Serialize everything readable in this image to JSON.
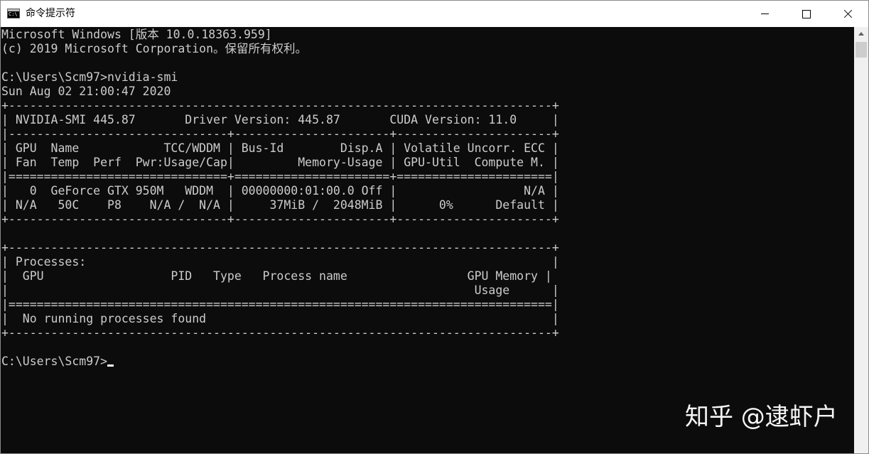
{
  "window": {
    "title": "命令提示符",
    "icon": "cmd-prompt-icon",
    "buttons": {
      "minimize": "minimize-icon",
      "maximize": "maximize-icon",
      "close": "close-icon"
    }
  },
  "colors": {
    "console_background": "#0c0c0c",
    "console_text": "#cccccc",
    "titlebar_background": "#ffffff"
  },
  "console": {
    "lines": [
      "Microsoft Windows [版本 10.0.18363.959]",
      "(c) 2019 Microsoft Corporation。保留所有权利。",
      "",
      "C:\\Users\\Scm97>nvidia-smi",
      "Sun Aug 02 21:00:47 2020",
      "+-----------------------------------------------------------------------------+",
      "| NVIDIA-SMI 445.87       Driver Version: 445.87       CUDA Version: 11.0     |",
      "|-------------------------------+----------------------+----------------------+",
      "| GPU  Name            TCC/WDDM | Bus-Id        Disp.A | Volatile Uncorr. ECC |",
      "| Fan  Temp  Perf  Pwr:Usage/Cap|         Memory-Usage | GPU-Util  Compute M. |",
      "|===============================+======================+======================|",
      "|   0  GeForce GTX 950M   WDDM  | 00000000:01:00.0 Off |                  N/A |",
      "| N/A   50C    P8    N/A /  N/A |     37MiB /  2048MiB |      0%      Default |",
      "+-------------------------------+----------------------+----------------------+",
      "",
      "+-----------------------------------------------------------------------------+",
      "| Processes:                                                                  |",
      "|  GPU                  PID   Type   Process name                 GPU Memory |",
      "|                                                                  Usage      |",
      "|=============================================================================|",
      "|  No running processes found                                                 |",
      "+-----------------------------------------------------------------------------+",
      "",
      "C:\\Users\\Scm97>"
    ]
  },
  "watermark": "知乎 @逮虾户"
}
